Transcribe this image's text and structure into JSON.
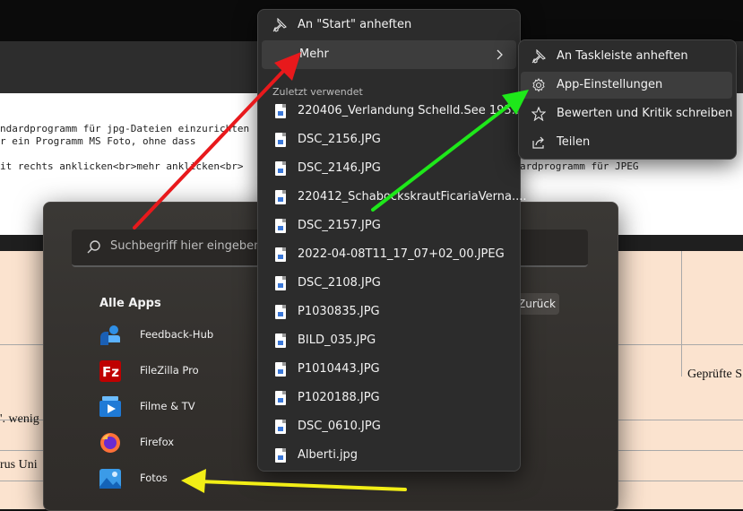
{
  "editor_lines": [
    "ndardprogramm für jpg-Dateien einzurichten",
    "r ein Programm MS Foto, ohne dass",
    "it rechts anklicken<br>mehr anklicken<br>",
    "ardprogramm für JPEG"
  ],
  "table_text": {
    "right_cell": "Geprüfte S",
    "left_row1": "'. wenig",
    "left_row2": "rus Uni"
  },
  "start_menu": {
    "search_placeholder": "Suchbegriff hier eingeben",
    "all_apps_title": "Alle Apps",
    "back_label": "Zurück",
    "apps": [
      {
        "label": "Feedback-Hub",
        "icon": "feedback-hub-icon"
      },
      {
        "label": "FileZilla Pro",
        "icon": "filezilla-icon"
      },
      {
        "label": "Filme & TV",
        "icon": "movies-tv-icon"
      },
      {
        "label": "Firefox",
        "icon": "firefox-icon"
      },
      {
        "label": "Fotos",
        "icon": "photos-icon"
      }
    ]
  },
  "jump_list": {
    "pin_start": "An \"Start\" anheften",
    "more": "Mehr",
    "recent_header": "Zuletzt verwendet",
    "files": [
      "220406_Verlandung Schelld.See 195...",
      "DSC_2156.JPG",
      "DSC_2146.JPG",
      "220412_SchabockskrautFicariaVerna....",
      "DSC_2157.JPG",
      "2022-04-08T11_17_07+02_00.JPEG",
      "DSC_2108.JPG",
      "P1030835.JPG",
      "BILD_035.JPG",
      "P1010443.JPG",
      "P1020188.JPG",
      "DSC_0610.JPG",
      "Alberti.jpg"
    ]
  },
  "submenu": {
    "pin_taskbar": "An Taskleiste anheften",
    "app_settings": "App-Einstellungen",
    "rate_review": "Bewerten und Kritik schreiben",
    "share": "Teilen"
  },
  "annotation_colors": {
    "red": "#e8191c",
    "green": "#1ee81a",
    "yellow": "#f2ee16"
  }
}
